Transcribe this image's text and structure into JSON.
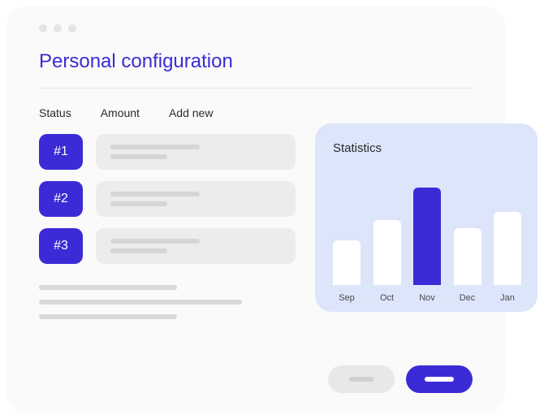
{
  "window": {
    "title": "Personal configuration",
    "tabs": [
      {
        "label": "Status"
      },
      {
        "label": "Amount"
      },
      {
        "label": "Add new"
      }
    ],
    "rows": [
      {
        "badge": "#1"
      },
      {
        "badge": "#2"
      },
      {
        "badge": "#3"
      }
    ]
  },
  "stats": {
    "title": "Statistics"
  },
  "chart_data": {
    "type": "bar",
    "categories": [
      "Sep",
      "Oct",
      "Nov",
      "Dec",
      "Jan"
    ],
    "values": [
      55,
      80,
      120,
      70,
      90
    ],
    "highlight_index": 2,
    "title": "Statistics",
    "ylim": [
      0,
      140
    ]
  }
}
